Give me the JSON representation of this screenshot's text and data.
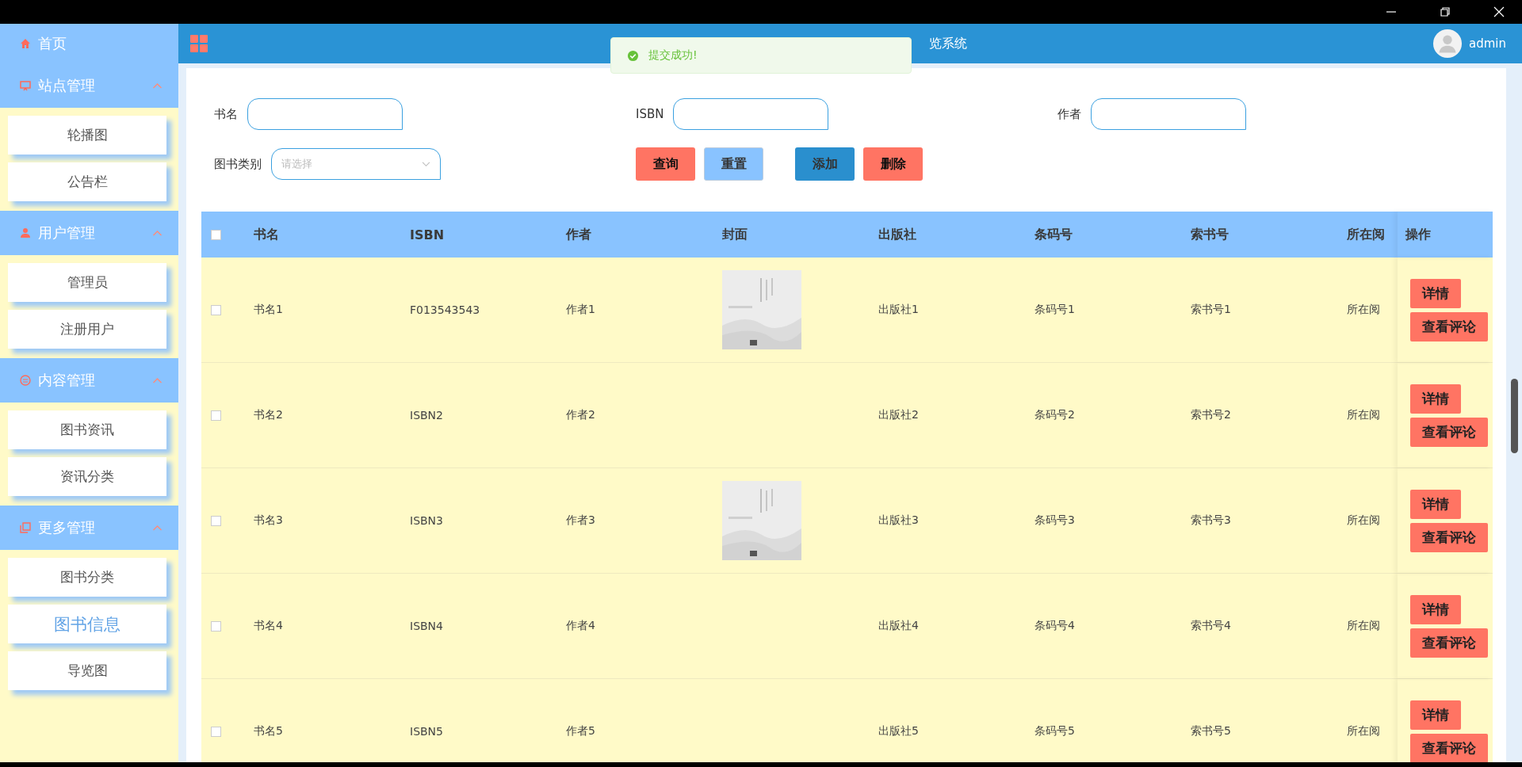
{
  "sidebar": {
    "home": "首页",
    "groups": [
      {
        "title": "站点管理",
        "expanded": true,
        "items": [
          {
            "label": "轮播图",
            "selected": false
          },
          {
            "label": "公告栏",
            "selected": false
          }
        ]
      },
      {
        "title": "用户管理",
        "expanded": true,
        "items": [
          {
            "label": "管理员",
            "selected": false
          },
          {
            "label": "注册用户",
            "selected": false
          }
        ]
      },
      {
        "title": "内容管理",
        "expanded": true,
        "items": [
          {
            "label": "图书资讯",
            "selected": false
          },
          {
            "label": "资讯分类",
            "selected": false
          }
        ]
      },
      {
        "title": "更多管理",
        "expanded": true,
        "items": [
          {
            "label": "图书分类",
            "selected": false
          },
          {
            "label": "图书信息",
            "selected": true
          },
          {
            "label": "导览图",
            "selected": false
          }
        ]
      }
    ]
  },
  "header": {
    "title": "览系统",
    "user": "admin"
  },
  "toast": {
    "message": "提交成功!"
  },
  "filters": {
    "fields": [
      {
        "label": "书名"
      },
      {
        "label": "ISBN"
      },
      {
        "label": "作者"
      }
    ],
    "category": {
      "label": "图书类别",
      "placeholder": "请选择"
    },
    "buttons": [
      {
        "label": "查询",
        "kind": "danger"
      },
      {
        "label": "重置",
        "kind": "light"
      },
      {
        "label": "添加",
        "kind": "primary"
      },
      {
        "label": "删除",
        "kind": "danger"
      }
    ]
  },
  "table": {
    "all_checked": false,
    "columns": [
      "书名",
      "ISBN",
      "作者",
      "封面",
      "出版社",
      "条码号",
      "索书号",
      "所在阅",
      "操作"
    ],
    "rows": [
      {
        "checked": false,
        "cells": [
          "书名1",
          "F013543543",
          "作者1"
        ],
        "cover": {
          "kind": "picture"
        },
        "rest": [
          "出版社1",
          "条码号1",
          "索书号1",
          "所在阅"
        ],
        "actions": [
          "详情",
          "查看评论"
        ]
      },
      {
        "checked": false,
        "cells": [
          "书名2",
          "ISBN2",
          "作者2"
        ],
        "rest": [
          "出版社2",
          "条码号2",
          "索书号2",
          "所在阅"
        ],
        "actions": [
          "详情",
          "查看评论"
        ]
      },
      {
        "checked": false,
        "cells": [
          "书名3",
          "ISBN3",
          "作者3"
        ],
        "cover": {
          "kind": "picture"
        },
        "rest": [
          "出版社3",
          "条码号3",
          "索书号3",
          "所在阅"
        ],
        "actions": [
          "详情",
          "查看评论"
        ]
      },
      {
        "checked": false,
        "cells": [
          "书名4",
          "ISBN4",
          "作者4"
        ],
        "rest": [
          "出版社4",
          "条码号4",
          "索书号4",
          "所在阅"
        ],
        "actions": [
          "详情",
          "查看评论"
        ]
      },
      {
        "checked": false,
        "cells": [
          "书名5",
          "ISBN5",
          "作者5"
        ],
        "rest": [
          "出版社5",
          "条码号5",
          "索书号5",
          "所在阅"
        ],
        "actions": [
          "详情",
          "查看评论"
        ]
      }
    ]
  }
}
